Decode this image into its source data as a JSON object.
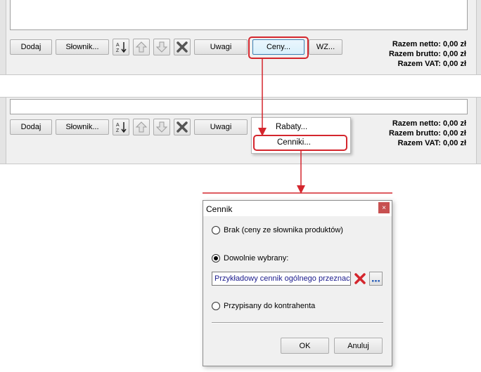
{
  "toolbar": {
    "add_label": "Dodaj",
    "dictionary_label": "Słownik...",
    "notes_label": "Uwagi",
    "prices_label": "Ceny...",
    "wz_label": "WZ..."
  },
  "totals": {
    "net": "Razem netto: 0,00 zł",
    "gross": "Razem brutto: 0,00 zł",
    "vat": "Razem VAT: 0,00 zł"
  },
  "popup_menu": {
    "items": [
      "Rabaty...",
      "Cenniki..."
    ]
  },
  "dialog": {
    "title": "Cennik",
    "close_glyph": "×",
    "options": [
      {
        "label": "Brak (ceny ze słownika produktów)",
        "selected": false
      },
      {
        "label": "Dowolnie wybrany:",
        "selected": true
      },
      {
        "label": "Przypisany do kontrahenta",
        "selected": false
      }
    ],
    "selected_pricelist": "Przykładowy cennik ogólnego przeznaczenia",
    "ok_label": "OK",
    "cancel_label": "Anuluj"
  },
  "icons": {
    "sort": "sort-az-icon",
    "up": "arrow-up-icon",
    "down": "arrow-down-icon",
    "delete": "delete-x-icon",
    "browse": "ellipsis-icon"
  },
  "colors": {
    "highlight": "#d4262d",
    "focused_button": "#3c7fb1",
    "combo_text": "#1a1a8c"
  }
}
